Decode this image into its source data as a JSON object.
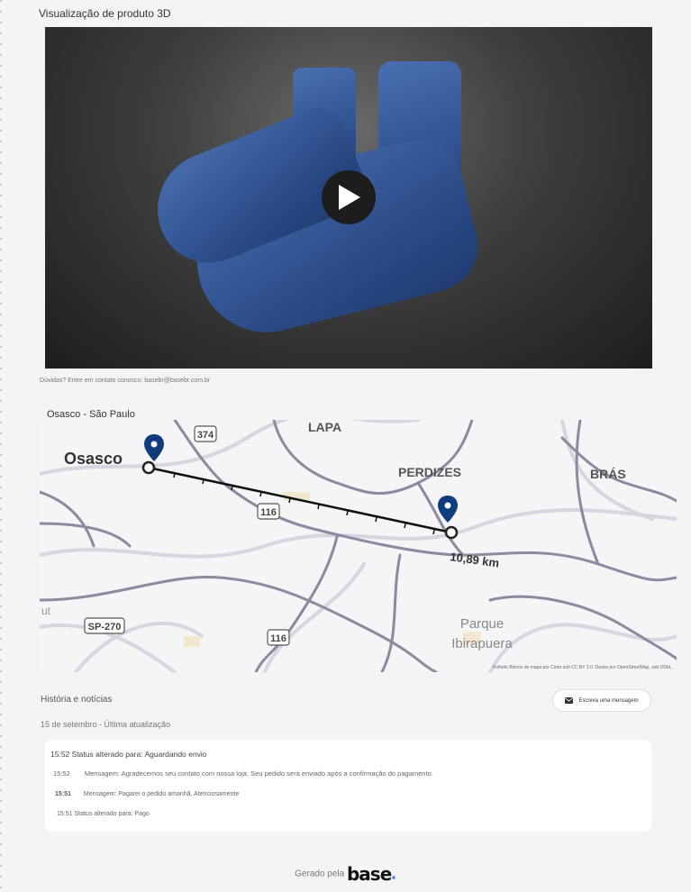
{
  "product": {
    "title": "Visualização de produto 3D"
  },
  "contact": {
    "text": "Dúvidas? Entre em contato conosco: basebr@basebr.com.br"
  },
  "map": {
    "title": "Osasco - São Paulo",
    "labels": {
      "osasco": "Osasco",
      "lapa": "LAPA",
      "perdizes": "PERDIZES",
      "bras": "BRÁS",
      "parque": "Parque",
      "ibirapuera": "Ibirapuera",
      "ut": "ut"
    },
    "shields": {
      "r374": "374",
      "r116a": "116",
      "r116b": "116",
      "sp270": "SP-270"
    },
    "distance": "10,89 km",
    "attribution": "Folheto Blocos de mapa por Carto sob CC BY 3.0. Dados por OpenStreetMap, sob ODbL."
  },
  "history": {
    "title": "História e notícias",
    "date": "15 de setembro - Última atualização",
    "message_button": "Escreva uma mensagem",
    "entries": [
      {
        "time": "15:52",
        "text": "Status alterado para: Aguardando envio"
      },
      {
        "time": "15:52",
        "text": "Mensagem: Agradecemos seu contato com nossa loja. Seu pedido será enviado após a confirmação do pagamento."
      },
      {
        "time": "15:51",
        "text": "Mensagem: Pagarei o pedido amanhã, Atenciosamente"
      },
      {
        "time": "15:51",
        "text": "Status alterado para: Pago"
      }
    ]
  },
  "footer": {
    "text": "Gerado pela",
    "brand": "base",
    "brand_dot": "."
  }
}
